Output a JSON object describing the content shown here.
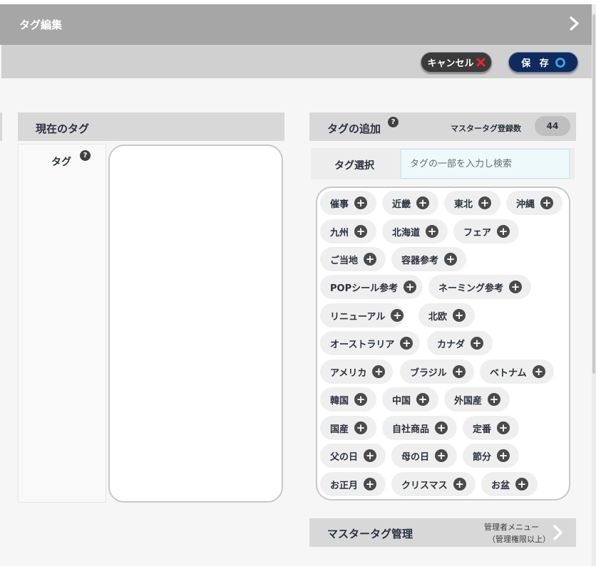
{
  "window": {
    "title": "タグ編集"
  },
  "actions": {
    "cancel_label": "キャンセル",
    "save_label": "保 存"
  },
  "left": {
    "section_title": "現在のタグ",
    "tag_label": "タグ"
  },
  "right": {
    "section_title": "タグの追加",
    "master_count_label": "マスタータグ登録数",
    "master_count": "44",
    "select_label": "タグ選択",
    "search_placeholder": "タグの一部を入力し検索",
    "tags": [
      "催事",
      "近畿",
      "東北",
      "沖縄",
      "九州",
      "北海道",
      "フェア",
      "ご当地",
      "容器参考",
      "POPシール参考",
      "ネーミング参考",
      "リニューアル",
      "北欧",
      "オーストラリア",
      "カナダ",
      "アメリカ",
      "ブラジル",
      "ベトナム",
      "韓国",
      "中国",
      "外国産",
      "国産",
      "自社商品",
      "定番",
      "父の日",
      "母の日",
      "節分",
      "お正月",
      "クリスマス",
      "お盆"
    ]
  },
  "master": {
    "title": "マスタータグ管理",
    "note_line1": "管理者メニュー",
    "note_line2": "（管理権限以上）"
  },
  "icons": {
    "help": "help-icon",
    "plus": "plus-circle-icon",
    "cancel": "x-icon",
    "save": "circle-icon",
    "chevron": "chevron-right-icon"
  },
  "colors": {
    "save_button": "#0f2a5c",
    "cancel_x": "#e8262b",
    "save_ring": "#39a0ea"
  }
}
